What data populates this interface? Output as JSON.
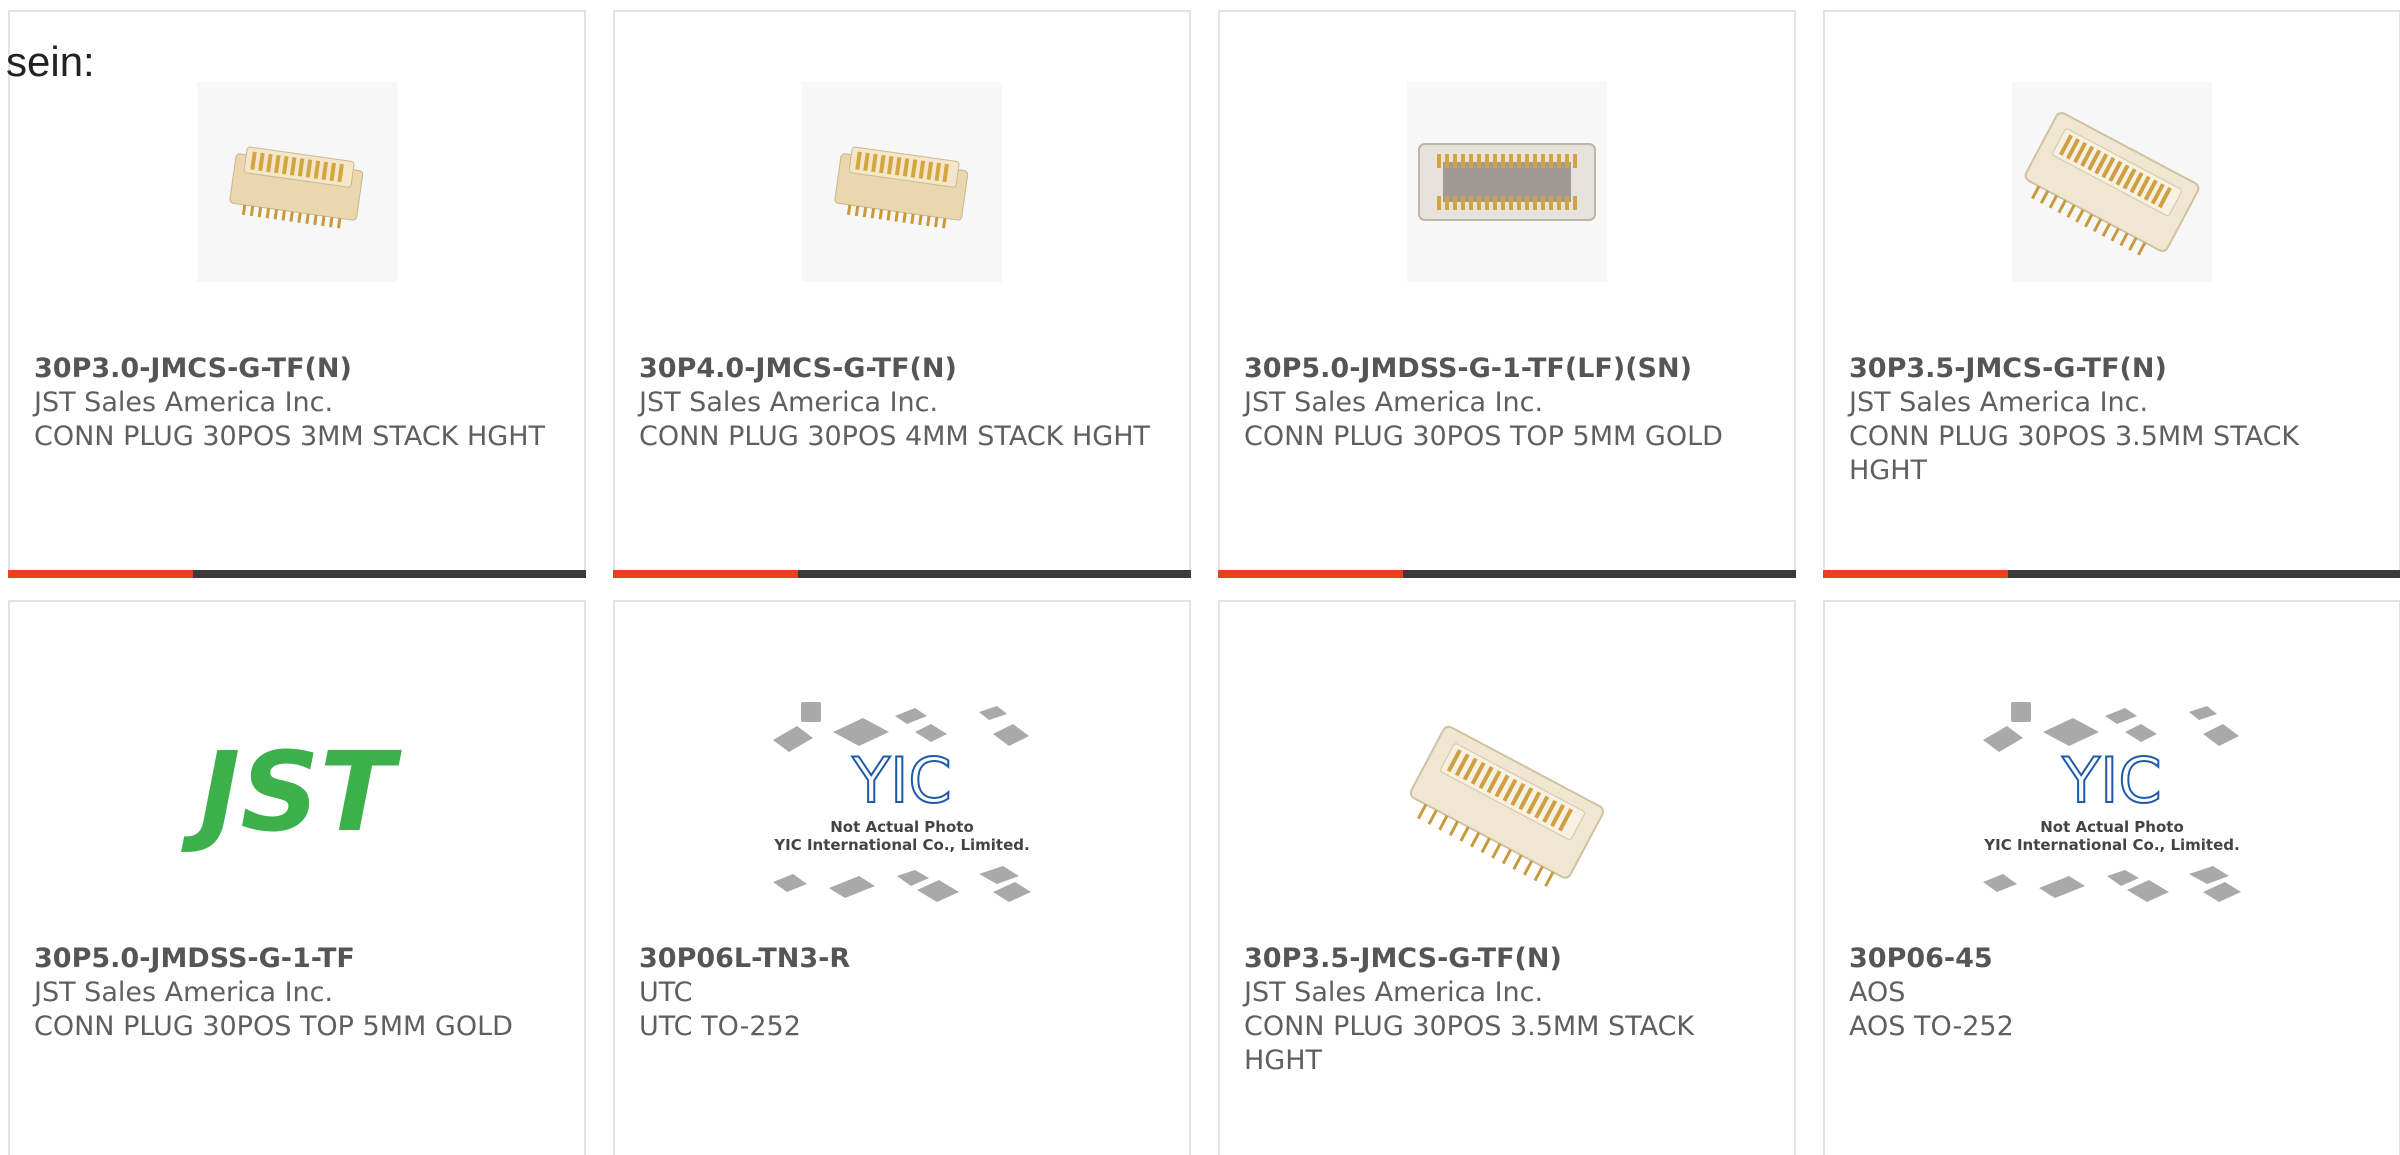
{
  "intro_text": "sein:",
  "accent_color": "#e8411e",
  "bar_color": "#3b3b3b",
  "products": [
    {
      "part_number": "30P3.0-JMCS-G-TF(N)",
      "manufacturer": "JST Sales America Inc.",
      "description": "CONN PLUG 30POS 3MM STACK HGHT",
      "image": "connector-small-icon",
      "progress_fraction": 0.32
    },
    {
      "part_number": "30P4.0-JMCS-G-TF(N)",
      "manufacturer": "JST Sales America Inc.",
      "description": "CONN PLUG 30POS 4MM STACK HGHT",
      "image": "connector-small-icon",
      "progress_fraction": 0.32
    },
    {
      "part_number": "30P5.0-JMDSS-G-1-TF(LF)(SN)",
      "manufacturer": "JST Sales America Inc.",
      "description": "CONN PLUG 30POS TOP 5MM GOLD",
      "image": "connector-top-icon",
      "progress_fraction": 0.32
    },
    {
      "part_number": "30P3.5-JMCS-G-TF(N)",
      "manufacturer": "JST Sales America Inc.",
      "description": "CONN PLUG 30POS 3.5MM STACK HGHT",
      "image": "connector-large-icon",
      "progress_fraction": 0.32
    },
    {
      "part_number": "30P5.0-JMDSS-G-1-TF",
      "manufacturer": "JST Sales America Inc.",
      "description": "CONN PLUG 30POS TOP 5MM GOLD",
      "image": "jst-logo"
    },
    {
      "part_number": "30P06L-TN3-R",
      "manufacturer": "UTC",
      "description": "UTC TO-252",
      "image": "not-actual-photo",
      "placeholder_line1": "Not Actual Photo",
      "placeholder_line2": "YIC International Co., Limited.",
      "placeholder_logo": "YIC"
    },
    {
      "part_number": "30P3.5-JMCS-G-TF(N)",
      "manufacturer": "JST Sales America Inc.",
      "description": "CONN PLUG 30POS 3.5MM STACK HGHT",
      "image": "connector-large-icon"
    },
    {
      "part_number": "30P06-45",
      "manufacturer": "AOS",
      "description": "AOS TO-252",
      "image": "not-actual-photo",
      "placeholder_line1": "Not Actual Photo",
      "placeholder_line2": "YIC International Co., Limited.",
      "placeholder_logo": "YIC"
    }
  ],
  "jst_logo_text": "JST"
}
